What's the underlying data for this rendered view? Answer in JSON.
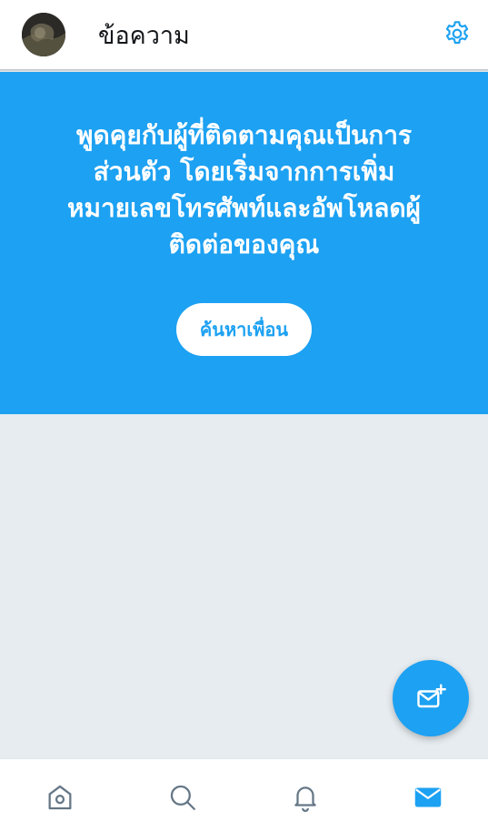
{
  "header": {
    "title": "ข้อความ",
    "avatar_icon": "profile-avatar",
    "settings_icon": "gear-icon"
  },
  "promo": {
    "text": "พูดคุยกับผู้ที่ติดตามคุณเป็นการส่วนตัว โดยเริ่มจากการเพิ่มหมายเลขโทรศัพท์และอัพโหลดผู้ติดต่อของคุณ",
    "button_label": "ค้นหาเพื่อน"
  },
  "fab": {
    "icon": "new-message-icon"
  },
  "bottom_nav": {
    "items": [
      {
        "name": "home",
        "icon": "home-icon"
      },
      {
        "name": "search",
        "icon": "search-icon"
      },
      {
        "name": "notifications",
        "icon": "bell-icon"
      },
      {
        "name": "messages",
        "icon": "mail-icon",
        "active": true
      }
    ]
  },
  "colors": {
    "accent": "#1da1f2",
    "background": "#e6ecf0",
    "text": "#14171a",
    "icon_inactive": "#657786"
  }
}
